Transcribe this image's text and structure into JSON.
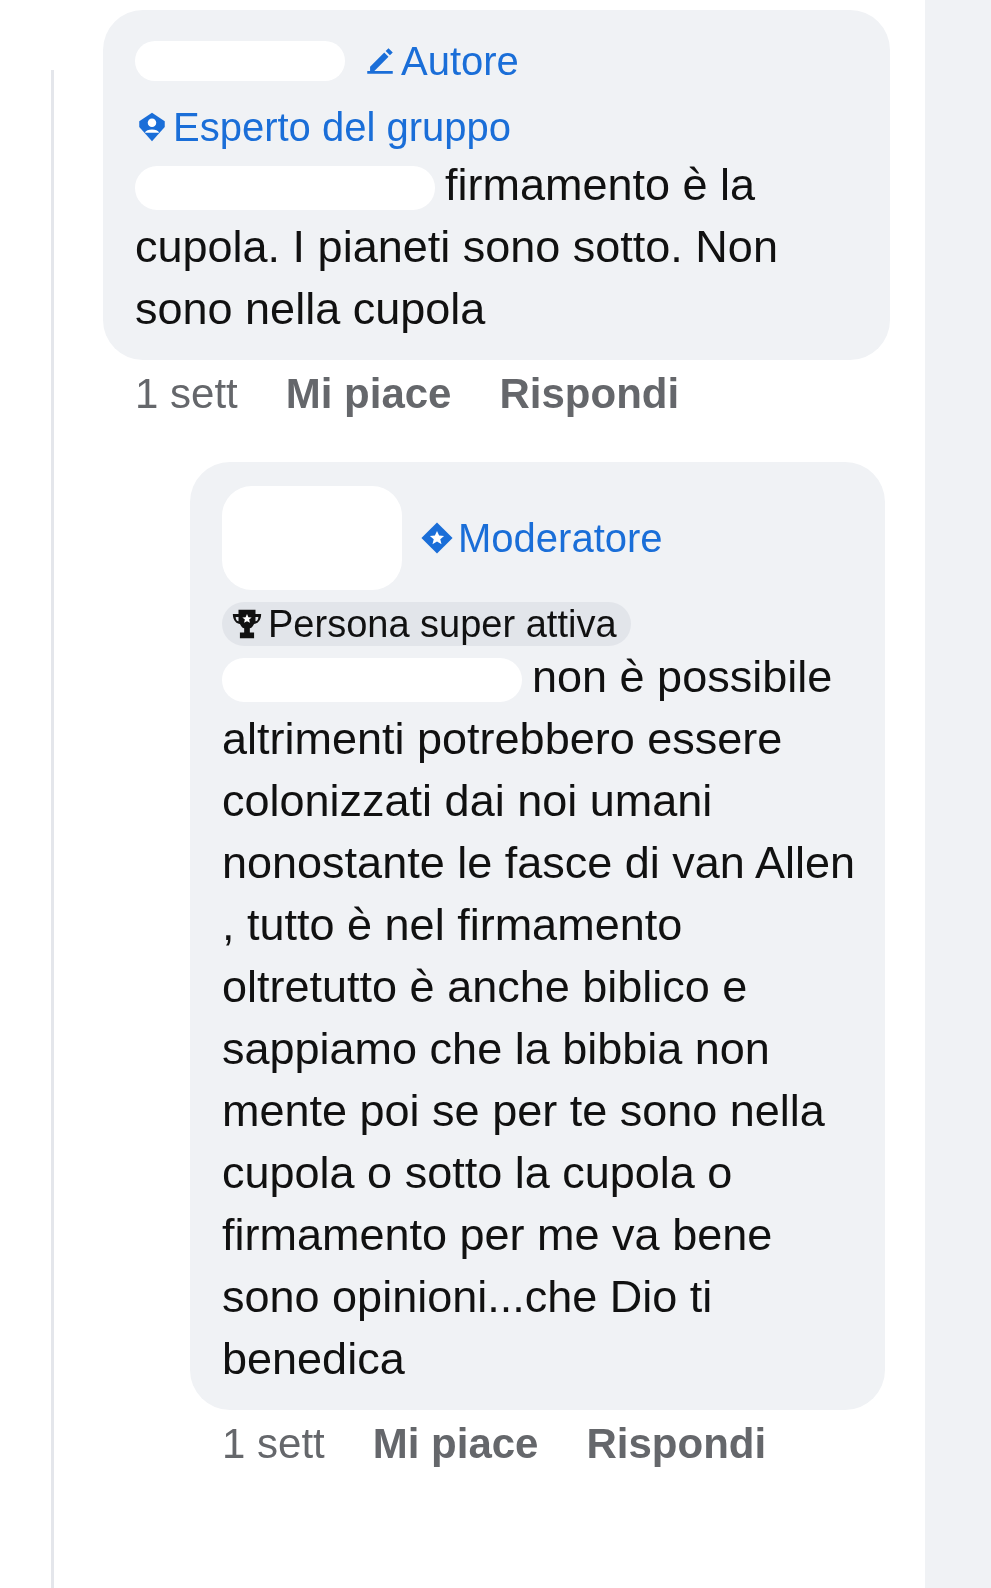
{
  "comments": [
    {
      "badges": [
        {
          "kind": "author",
          "label": "Autore"
        },
        {
          "kind": "expert",
          "label": "Esperto del gruppo"
        }
      ],
      "text": "firmamento è la cupola. I pianeti sono sotto. Non sono nella cupola",
      "time": "1 sett",
      "like": "Mi piace",
      "reply": "Rispondi"
    },
    {
      "badges": [
        {
          "kind": "moderator",
          "label": "Moderatore"
        },
        {
          "kind": "active",
          "label": "Persona super attiva"
        }
      ],
      "text": "non è possibile altrimenti potrebbero essere colonizzati dai noi umani nonostante le fasce di van Allen , tutto è nel firmamento oltretutto è anche biblico e sappiamo che la bibbia non mente poi se per te sono nella cupola o sotto la cupola o firmamento per me va bene sono opinioni...che Dio ti benedica",
      "time": "1 sett",
      "like": "Mi piace",
      "reply": "Rispondi"
    }
  ]
}
